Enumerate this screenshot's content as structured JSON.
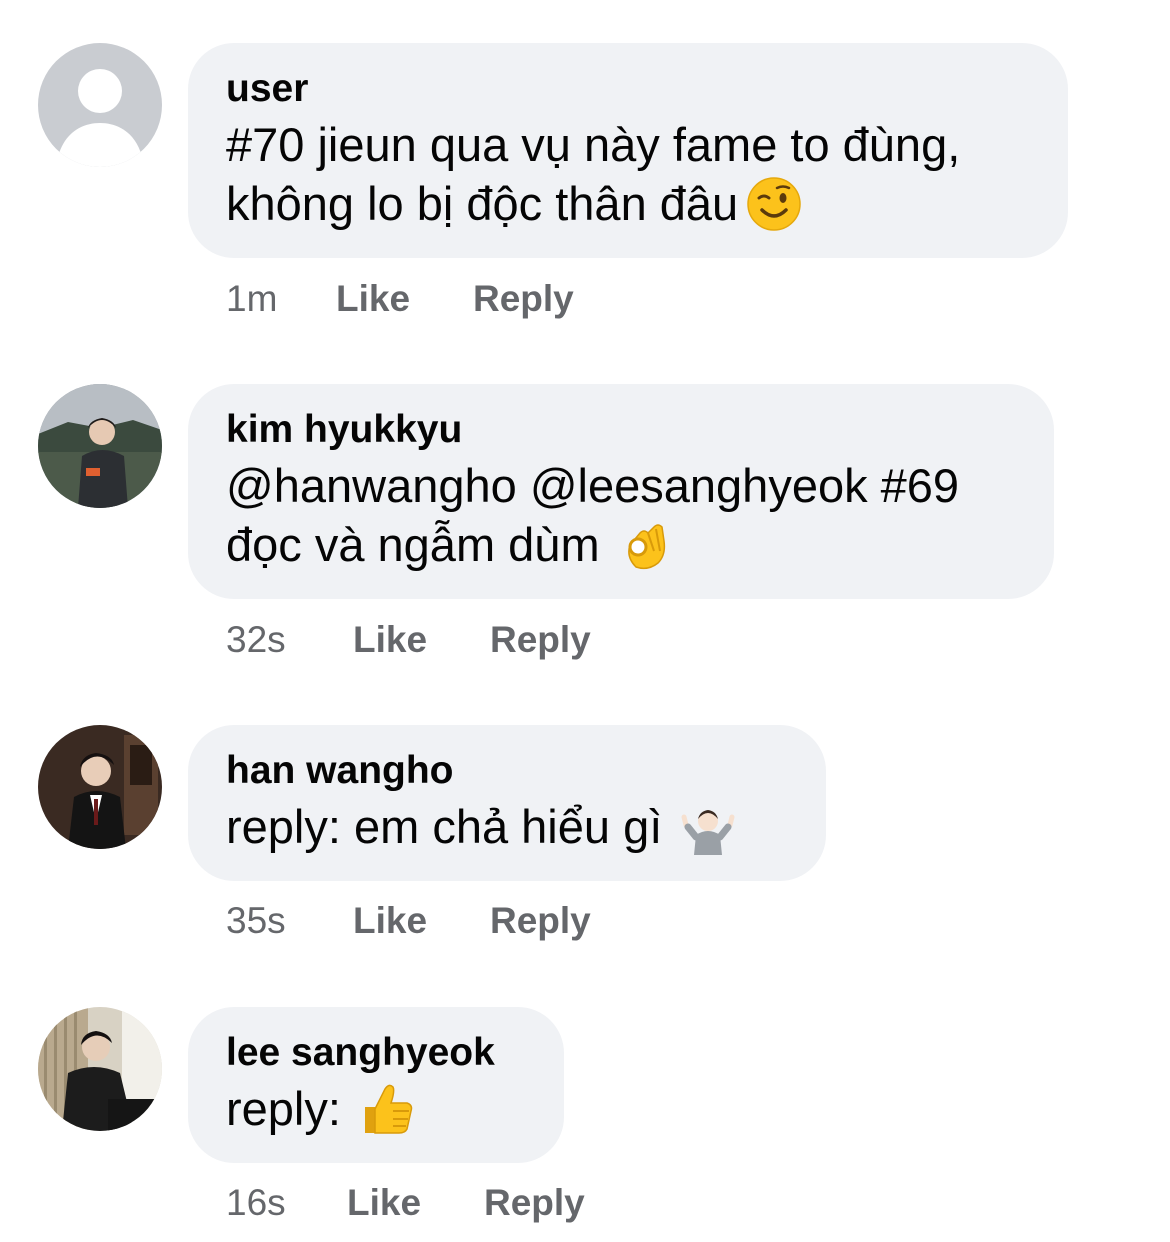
{
  "comments": [
    {
      "author": "user",
      "lines": [
        "#70 jieun qua vụ này fame to đùng,",
        "không lo bị độc thân đâu"
      ],
      "emoji": "winking-face-emoji",
      "time": "1m",
      "like_label": "Like",
      "reply_label": "Reply"
    },
    {
      "author": "kim hyukkyu",
      "lines": [
        "@hanwangho @leesanghyeok #69",
        "đọc và ngẫm dùm"
      ],
      "emoji": "ok-hand-emoji",
      "time": "32s",
      "like_label": "Like",
      "reply_label": "Reply"
    },
    {
      "author": "han wangho",
      "lines": [
        "reply: em chả hiểu gì"
      ],
      "emoji": "person-shrugging-emoji",
      "time": "35s",
      "like_label": "Like",
      "reply_label": "Reply"
    },
    {
      "author": "lee sanghyeok",
      "lines": [
        "reply:"
      ],
      "emoji": "thumbs-up-emoji",
      "time": "16s",
      "like_label": "Like",
      "reply_label": "Reply"
    }
  ],
  "colors": {
    "bubble": "#f0f2f5",
    "text": "#050505",
    "meta": "#65676b",
    "default_avatar_bg": "#c9ccd1"
  }
}
